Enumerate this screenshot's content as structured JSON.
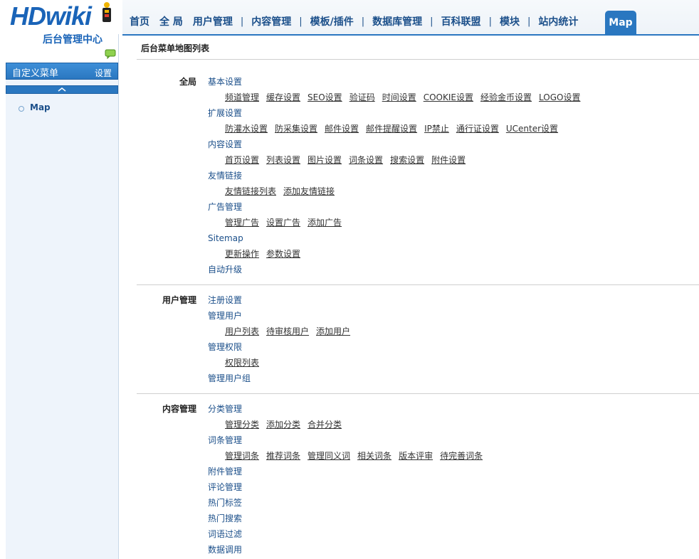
{
  "logo": {
    "text": "HDwiki",
    "subtitle": "后台管理中心",
    "accent": "#1a64b8"
  },
  "topnav": {
    "items": [
      "首页",
      "全 局",
      "用户管理",
      "内容管理",
      "模板/插件",
      "数据库管理",
      "百科联盟",
      "模块",
      "站内统计"
    ],
    "separator": "|",
    "active": "Map"
  },
  "sidebar": {
    "custom_menu_title": "自定义菜单",
    "custom_menu_settings": "设置",
    "items": [
      "Map"
    ]
  },
  "main": {
    "title": "后台菜单地图列表",
    "sections": [
      {
        "title": "全局",
        "groups": [
          {
            "label": "基本设置",
            "links": [
              "频道管理",
              "缓存设置",
              "SEO设置",
              "验证码",
              "时间设置",
              "COOKIE设置",
              "经验金币设置",
              "LOGO设置"
            ]
          },
          {
            "label": "扩展设置",
            "links": [
              "防灌水设置",
              "防采集设置",
              "邮件设置",
              "邮件提醒设置",
              "IP禁止",
              "通行证设置",
              "UCenter设置"
            ]
          },
          {
            "label": "内容设置",
            "links": [
              "首页设置",
              "列表设置",
              "图片设置",
              "词条设置",
              "搜索设置",
              "附件设置"
            ]
          },
          {
            "label": "友情链接",
            "links": [
              "友情链接列表",
              "添加友情链接"
            ]
          },
          {
            "label": "广告管理",
            "links": [
              "管理广告",
              "设置广告",
              "添加广告"
            ]
          },
          {
            "label": "Sitemap",
            "links": [
              "更新操作",
              "参数设置"
            ]
          },
          {
            "label": "自动升级",
            "links": []
          }
        ]
      },
      {
        "title": "用户管理",
        "groups": [
          {
            "label": "注册设置",
            "links": []
          },
          {
            "label": "管理用户",
            "links": [
              "用户列表",
              "待审核用户",
              "添加用户"
            ]
          },
          {
            "label": "管理权限",
            "links": [
              "权限列表"
            ]
          },
          {
            "label": "管理用户组",
            "links": []
          }
        ]
      },
      {
        "title": "内容管理",
        "groups": [
          {
            "label": "分类管理",
            "links": [
              "管理分类",
              "添加分类",
              "合并分类"
            ]
          },
          {
            "label": "词条管理",
            "links": [
              "管理词条",
              "推荐词条",
              "管理同义词",
              "相关词条",
              "版本评审",
              "待完善词条"
            ]
          },
          {
            "label": "附件管理",
            "links": []
          },
          {
            "label": "评论管理",
            "links": []
          },
          {
            "label": "热门标签",
            "links": []
          },
          {
            "label": "热门搜索",
            "links": []
          },
          {
            "label": "词语过滤",
            "links": []
          },
          {
            "label": "数据调用",
            "links": []
          }
        ]
      }
    ]
  },
  "colors": {
    "nav_blue": "#2a77c0",
    "link_blue": "#1b4f8a"
  }
}
